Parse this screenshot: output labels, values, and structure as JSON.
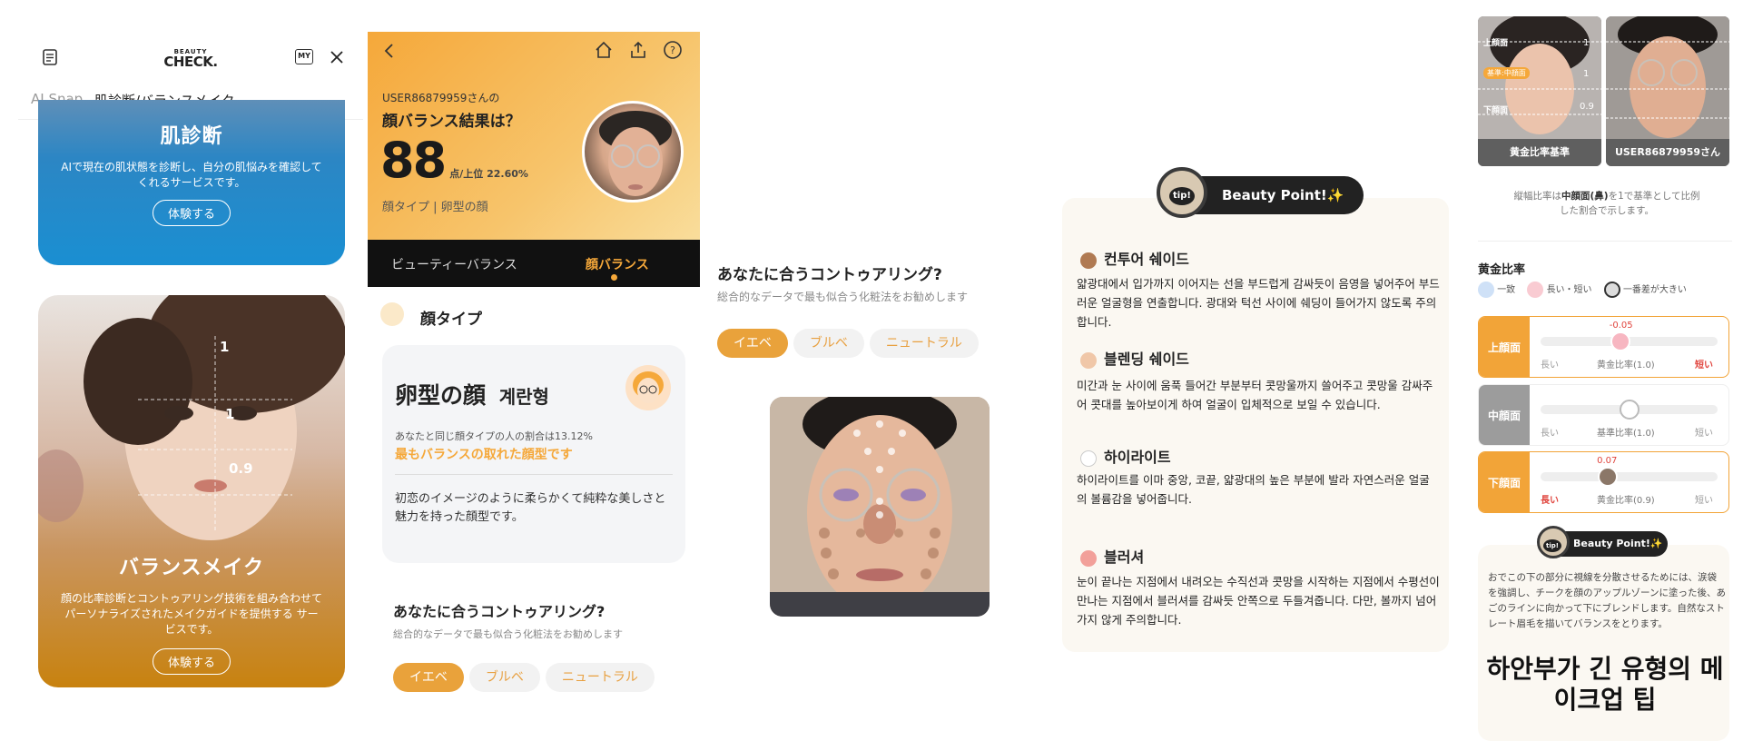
{
  "panel1": {
    "brand_top": "BEAUTY",
    "brand_bottom": "CHECK.",
    "my_label": "MY",
    "tabs": [
      "AI Snap",
      "肌診断/バランスメイク"
    ],
    "skin_card": {
      "title": "肌診断",
      "desc": "AIで現在の肌状態を診断し、自分の肌悩みを確認してくれるサービスです。",
      "button": "体験する"
    },
    "balance_card": {
      "title": "バランスメイク",
      "desc": "顔の比率診断とコントゥアリング技術を組み合わせてパーソナライズされたメイクガイドを提供する サービスです。",
      "button": "体験する",
      "ratios": [
        "1",
        "1",
        "0.9"
      ]
    }
  },
  "panel2": {
    "user_line": "USER86879959さんの",
    "headline": "顔バランス結果は？",
    "score": "88",
    "score_unit": "点/上位 22.60%",
    "face_type_line": "顔タイプ | 卵型の顔",
    "tabs": [
      "ビューティーバランス",
      "顔バランス"
    ],
    "section_title": "顔タイプ",
    "face_name": "卵型の顔",
    "face_name_kr": "계란형",
    "ratio_text": "あなたと同じ顔タイプの人の割合は13.12%",
    "highlight": "最もバランスの取れた顔型です",
    "desc": "初恋のイメージのように柔らかくて純粋な美しさと魅力を持った顔型です。",
    "contour_title": "あなたに合うコントゥアリング?",
    "contour_sub": "総合的なデータで最も似合う化粧法をお勧めします",
    "chips": [
      "イエベ",
      "ブルベ",
      "ニュートラル"
    ]
  },
  "panel3": {
    "contour_title": "あなたに合うコントゥアリング?",
    "contour_sub": "総合的なデータで最も似合う化粧法をお勧めします",
    "chips": [
      "イエベ",
      "ブルベ",
      "ニュートラル"
    ]
  },
  "panel4": {
    "badge_tip": "tip!",
    "badge": "Beauty Point!✨",
    "sections": [
      {
        "title": "컨투어 쉐이드",
        "color": "#b07a52",
        "body": "얇광대에서 입가까지 이어지는 선을 부드럽게 감싸듯이 음영을 넣어주어 부드러운 얼굴형을 연출합니다. 광대와 턱선 사이에 쉐딩이 들어가지 않도록 주의합니다."
      },
      {
        "title": "블렌딩 쉐이드",
        "color": "#f0c7a8",
        "body": "미간과 눈 사이에 움푹 들어간 부분부터 콧망울까지 쓸어주고 콧망울 감싸주어 콧대를 높아보이게 하여 얼굴이 입체적으로 보일 수 있습니다."
      },
      {
        "title": "하이라이트",
        "color": "#ffffff",
        "body": "하이라이트를 이마 중앙, 코끝, 얇광대의 높은 부분에 발라 자연스러운 얼굴의 볼륨감을 넣어줍니다."
      },
      {
        "title": "블러셔",
        "color": "#f2a09a",
        "body": "눈이 끝나는 지점에서 내려오는 수직선과 콧망을 시작하는 지점에서 수평선이 만나는 지점에서 블러셔를 감싸듯 안쪽으로 두들겨줍니다. 다만, 볼까지 넘어가지 않게 주의합니다."
      }
    ]
  },
  "panel5": {
    "photo_left_caption": "黄金比率基準",
    "photo_right_caption": "USER86879959さん",
    "photo_labels": {
      "upper": "上顔面",
      "mid_badge": "基準:中顔面",
      "lower": "下顔面",
      "v1": "1",
      "v2": "1",
      "v3": "0.9"
    },
    "note_pre": "縦幅比率は",
    "note_bold": "中顔面(鼻)",
    "note_post": "を1で基準として比例した割合で示します。",
    "golden_title": "黄金比率",
    "legend": [
      "一致",
      "長い・短い",
      "一番差が大きい"
    ],
    "rows": [
      {
        "name": "上顔面",
        "value": "-0.05",
        "left": "長い",
        "center": "黄金比率(1.0)",
        "right": "短い",
        "color": "#f2a438",
        "pos": 0.45
      },
      {
        "name": "中顔面",
        "value": "",
        "left": "長い",
        "center": "基準比率(1.0)",
        "right": "短い",
        "color": "#9c9c9c",
        "pos": 0.5
      },
      {
        "name": "下顔面",
        "value": "0.07",
        "left": "長い",
        "center": "黄金比率(0.9)",
        "right": "短い",
        "color": "#f2a438",
        "pos": 0.38
      }
    ],
    "badge_tip": "tip!",
    "badge": "Beauty Point!✨",
    "tip_text": "おでこの下の部分に視線を分散させるためには、涙袋を強調し、チークを顔のアップルゾーンに塗った後、あごのラインに向かって下にブレンドします。自然なストレート眉毛を描いてバランスをとります。",
    "big_caption": "하안부가 긴 유형의 메이크업 팁"
  },
  "colors": {
    "accent": "#f5a83a",
    "dark": "#111111",
    "pink": "#f28a9b"
  }
}
